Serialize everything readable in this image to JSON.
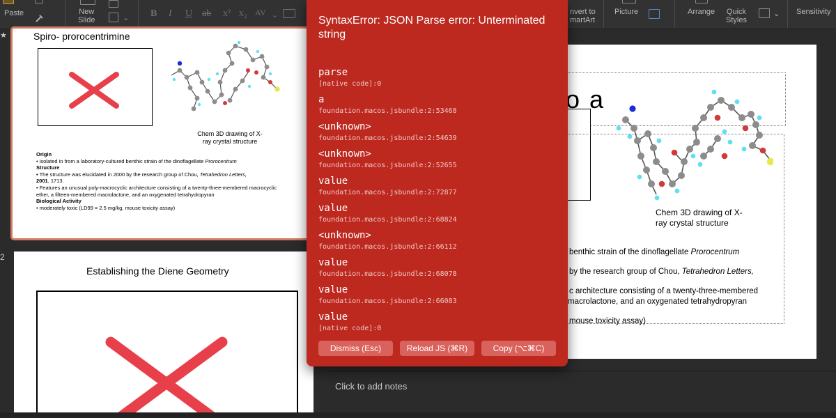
{
  "ribbon": {
    "paste_label": "Paste",
    "new_slide_label": "New\nSlide",
    "convert_label": "nvert to\nmartArt",
    "picture_label": "Picture",
    "arrange_label": "Arrange",
    "quick_styles_label": "Quick\nStyles",
    "sensitivity_label": "Sensitivity",
    "format_glyphs": [
      "B",
      "I",
      "U",
      "ab",
      "x²",
      "x₂",
      "AV"
    ]
  },
  "thumbnails": [
    {
      "number": "",
      "star": "★",
      "title": "Spiro- prorocentrimine",
      "caption": "Chem 3D drawing of X-\nray crystal structure",
      "body": [
        {
          "type": "heading",
          "text": "Origin"
        },
        {
          "type": "bullet",
          "text": "• isolated in from a laboratory-cultured benthic strain of the dinoflagellate ",
          "italic": "Prorocentrum"
        },
        {
          "type": "heading",
          "text": "Structure"
        },
        {
          "type": "bullet",
          "text": "• The structure was elucidated in 2000 by the research group of Chou, ",
          "italic": "Tetrahedron Letters,",
          "bold": "2001",
          "tail": ", 1713."
        },
        {
          "type": "bullet",
          "text": "• Features an unusual poly-macrocyclic architecture consisting of a twenty-three-membered macrocyclic ether, a fifteen-membered macrolactone, and an oxygenated tetrahydropyran"
        },
        {
          "type": "heading",
          "text": "Biological Activity"
        },
        {
          "type": "bullet",
          "text": "• moderately toxic (LD99 = 2.5 mg/kg, mouse toxicity assay)"
        }
      ]
    },
    {
      "number": "2",
      "title": "Establishing the Diene Geometry"
    }
  ],
  "main_slide": {
    "title_fragment": "o a",
    "caption_line1": "Chem 3D drawing of X-",
    "caption_line2": "ray crystal structure",
    "body_lines": [
      {
        "text": "benthic strain of the dinoflagellate ",
        "italic": "Prorocentrum"
      },
      {
        "text": "by the research group of Chou, ",
        "italic": "Tetrahedron Letters,"
      },
      {
        "text": "c architecture consisting of a twenty-three-membered"
      },
      {
        "text": " macrolactone, and an oxygenated tetrahydropyran"
      },
      {
        "text": "mouse toxicity assay)"
      }
    ]
  },
  "notes": {
    "placeholder": "Click to add notes"
  },
  "error": {
    "title": "SyntaxError: JSON Parse error: Unterminated string",
    "frames": [
      {
        "fn": "parse",
        "loc": "[native code]:0"
      },
      {
        "fn": "a",
        "loc": "foundation.macos.jsbundle:2:53468"
      },
      {
        "fn": "<unknown>",
        "loc": "foundation.macos.jsbundle:2:54639"
      },
      {
        "fn": "<unknown>",
        "loc": "foundation.macos.jsbundle:2:52655"
      },
      {
        "fn": "value",
        "loc": "foundation.macos.jsbundle:2:72877"
      },
      {
        "fn": "value",
        "loc": "foundation.macos.jsbundle:2:68824"
      },
      {
        "fn": "<unknown>",
        "loc": "foundation.macos.jsbundle:2:66112"
      },
      {
        "fn": "value",
        "loc": "foundation.macos.jsbundle:2:68078"
      },
      {
        "fn": "value",
        "loc": "foundation.macos.jsbundle:2:66083"
      },
      {
        "fn": "value",
        "loc": "[native code]:0"
      }
    ],
    "buttons": {
      "dismiss": "Dismiss (Esc)",
      "reload": "Reload JS (⌘R)",
      "copy": "Copy (⌥⌘C)"
    }
  },
  "colors": {
    "error_bg": "#bd281f",
    "error_button": "#d9625c",
    "placeholder_x": "#e8404a",
    "selected_outline": "#d27a63"
  }
}
